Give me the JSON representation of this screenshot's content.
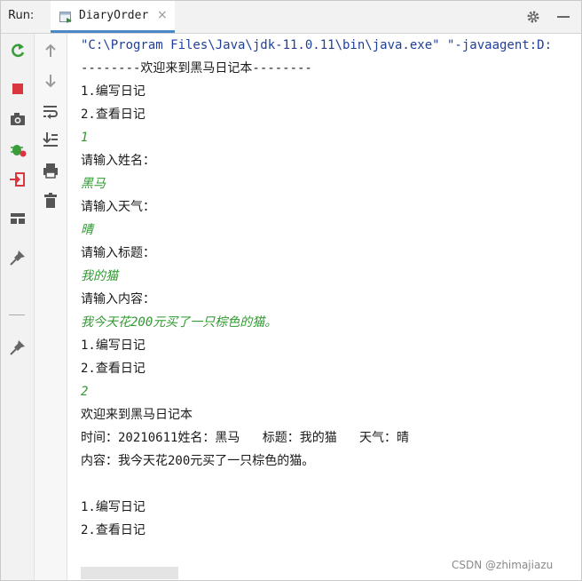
{
  "header": {
    "run_label": "Run:",
    "tab_title": "DiaryOrder",
    "close_glyph": "×"
  },
  "toolbar_left": {
    "icons": [
      "rerun-icon",
      "stop-icon",
      "camera-icon",
      "debug-icon",
      "exit-icon",
      "layout-icon",
      "pin-icon",
      "pin-icon"
    ]
  },
  "toolbar_right": {
    "icons": [
      "up-arrow-icon",
      "down-arrow-icon",
      "soft-wrap-icon",
      "scroll-to-end-icon",
      "print-icon",
      "trash-icon"
    ]
  },
  "console": {
    "lines": [
      {
        "text": "\"C:\\Program Files\\Java\\jdk-11.0.11\\bin\\java.exe\" \"-javaagent:D:",
        "kind": "cmd"
      },
      {
        "text": "--------欢迎来到黑马日记本--------",
        "kind": "out"
      },
      {
        "text": "1.编写日记",
        "kind": "out"
      },
      {
        "text": "2.查看日记",
        "kind": "out"
      },
      {
        "text": "1",
        "kind": "input"
      },
      {
        "text": "请输入姓名：",
        "kind": "out"
      },
      {
        "text": "黑马",
        "kind": "input"
      },
      {
        "text": "请输入天气：",
        "kind": "out"
      },
      {
        "text": "晴",
        "kind": "input"
      },
      {
        "text": "请输入标题：",
        "kind": "out"
      },
      {
        "text": "我的猫",
        "kind": "input"
      },
      {
        "text": "请输入内容：",
        "kind": "out"
      },
      {
        "text": "我今天花200元买了一只棕色的猫。",
        "kind": "input"
      },
      {
        "text": "1.编写日记",
        "kind": "out"
      },
      {
        "text": "2.查看日记",
        "kind": "out"
      },
      {
        "text": "2",
        "kind": "input"
      },
      {
        "text": "欢迎来到黑马日记本",
        "kind": "out"
      },
      {
        "text": "时间：20210611姓名：黑马   标题：我的猫   天气：晴",
        "kind": "out"
      },
      {
        "text": "内容：我今天花200元买了一只棕色的猫。",
        "kind": "out"
      },
      {
        "text": "",
        "kind": "out"
      },
      {
        "text": "1.编写日记",
        "kind": "out"
      },
      {
        "text": "2.查看日记",
        "kind": "out"
      }
    ]
  },
  "watermark": "CSDN @zhimajiazu",
  "colors": {
    "command": "#1f3f9a",
    "user_input": "#2f9a2f",
    "output": "#1a1a1a",
    "accent": "#4a88c7"
  }
}
